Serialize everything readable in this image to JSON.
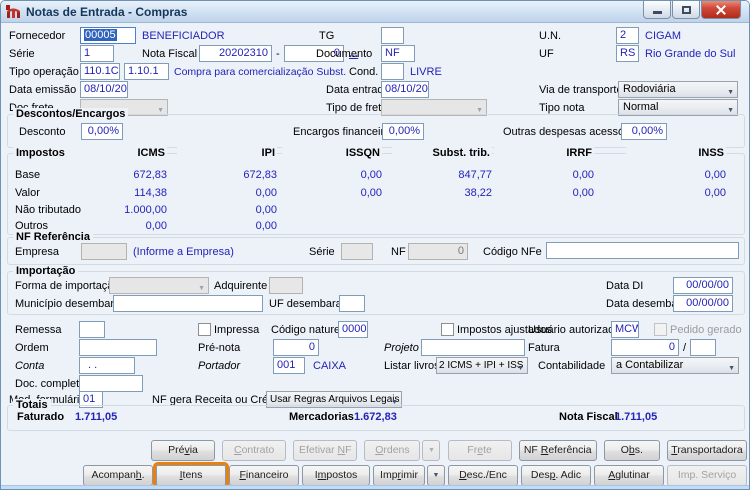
{
  "window": {
    "title": "Notas de Entrada - Compras"
  },
  "icons": {
    "combo_chevron": "▼",
    "dropdown_arrow": "▼"
  },
  "header": {
    "fornecedor_label": "Fornecedor",
    "fornecedor_value": "00005",
    "fornecedor_name": "BENEFICIADOR",
    "tg_label": "TG",
    "tg_value": "",
    "un_label": "U.N.",
    "un_value": "2",
    "un_name": "CIGAM",
    "serie_label": "Série",
    "serie_value": "1",
    "nota_fiscal_label": "Nota Fiscal",
    "nota_fiscal_value": "20202310",
    "nota_fiscal_dash": "-",
    "nota_fiscal_sufixo": "0",
    "nota_fiscal_more": "...",
    "documento_label": "Documento",
    "documento_value": "NF",
    "uf_label": "UF",
    "uf_value": "RS",
    "uf_name": "Rio Grande do Sul",
    "tipo_operacao_label": "Tipo operação",
    "tipo_operacao_value": "110.1C",
    "tipo_operacao_value2": "1.10.1",
    "tipo_operacao_desc": "Compra para comercialização Subst.",
    "cond_pag_label": "Cond. pag.",
    "cond_pag_value": "",
    "cond_pag_desc": "LIVRE",
    "data_emissao_label": "Data emissão",
    "data_emissao_value": "08/10/20",
    "data_entrada_label": "Data entrada",
    "data_entrada_value": "08/10/20",
    "via_transporte_label": "Via de transporte",
    "via_transporte_value": "Rodoviária",
    "doc_frete_label": "Doc frete",
    "doc_frete_value": "",
    "tipo_frete_label": "Tipo de frete",
    "tipo_frete_value": "",
    "tipo_nota_label": "Tipo nota",
    "tipo_nota_value": "Normal"
  },
  "descontos": {
    "title": "Descontos/Encargos",
    "desconto_label": "Desconto",
    "desconto_value": "0,00%",
    "encargos_label": "Encargos financeiros",
    "encargos_value": "0,00%",
    "outras_label": "Outras despesas acessórias",
    "outras_value": "0,00%"
  },
  "impostos": {
    "title": "Impostos",
    "columns": [
      "ICMS",
      "IPI",
      "ISSQN",
      "Subst. trib.",
      "IRRF",
      "INSS"
    ],
    "rows": [
      {
        "label": "Base",
        "values": [
          "672,83",
          "672,83",
          "0,00",
          "847,77",
          "0,00",
          "0,00"
        ]
      },
      {
        "label": "Valor",
        "values": [
          "114,38",
          "0,00",
          "0,00",
          "38,22",
          "0,00",
          "0,00"
        ]
      },
      {
        "label": "Não tributado",
        "values": [
          "1.000,00",
          "0,00",
          "",
          "",
          "",
          ""
        ]
      },
      {
        "label": "Outros",
        "values": [
          "0,00",
          "0,00",
          "",
          "",
          "",
          ""
        ]
      }
    ]
  },
  "nf_referencia": {
    "title": "NF Referência",
    "empresa_label": "Empresa",
    "empresa_value": "",
    "empresa_hint": "(Informe a Empresa)",
    "serie_label": "Série",
    "serie_value": "",
    "nf_label": "NF",
    "nf_value": "0",
    "codigo_nfe_label": "Código NFe",
    "codigo_nfe_value": ""
  },
  "importacao": {
    "title": "Importação",
    "forma_label": "Forma de importação",
    "forma_value": "",
    "adquirente_label": "Adquirente",
    "adquirente_value": "",
    "data_di_label": "Data DI",
    "data_di_value": "00/00/00",
    "municipio_label": "Município desembaraço",
    "municipio_value": "",
    "uf_label": "UF desembaraço",
    "uf_value": "",
    "data_desembaraco_label": "Data desembaraço",
    "data_desembaraco_value": "00/00/00"
  },
  "detalhes": {
    "remessa_label": "Remessa",
    "remessa_value": "",
    "impressa_label": "Impressa",
    "codigo_natureza_label": "Código natureza",
    "codigo_natureza_value": "0000",
    "impostos_ajustados_label": "Impostos ajustados",
    "usuario_label": "Usuário autorizado",
    "usuario_value": "MCW",
    "pedido_gerado_label": "Pedido gerado",
    "ordem_label": "Ordem",
    "ordem_value": "",
    "pre_nota_label": "Pré-nota",
    "pre_nota_value": "0",
    "projeto_label": "Projeto",
    "projeto_value": "",
    "fatura_label": "Fatura",
    "fatura_value": "0",
    "fatura_sep": "/",
    "fatura_value2": "",
    "conta_label": "Conta",
    "conta_value": ". .",
    "portador_label": "Portador",
    "portador_value": "001",
    "portador_name": "CAIXA",
    "listar_livros_label": "Listar livros",
    "listar_livros_value": "2 ICMS + IPI + ISS",
    "contabilidade_label": "Contabilidade",
    "contabilidade_value": "a Contabilizar",
    "doc_completo_label": "Doc. completo",
    "doc_completo_value": "",
    "mod_formulario_label": "Mod. formulário",
    "mod_formulario_value": "01",
    "nf_gera_label": "NF gera Receita ou Crédito",
    "nf_gera_value": "Usar Regras Arquivos Legais"
  },
  "totais": {
    "title": "Totais",
    "faturado_label": "Faturado",
    "faturado_value": "1.711,05",
    "mercadorias_label": "Mercadorias",
    "mercadorias_value": "1.672,83",
    "nota_fiscal_label": "Nota Fiscal",
    "nota_fiscal_value": "1.711,05"
  },
  "buttons": {
    "row1": [
      {
        "pre": "Pré",
        "u": "v",
        "post": "ia"
      },
      {
        "pre": "",
        "u": "C",
        "post": "ontrato"
      },
      {
        "pre": "Efetivar ",
        "u": "N",
        "post": "F"
      },
      {
        "pre": "",
        "u": "O",
        "post": "rdens"
      },
      {
        "pre": "Fr",
        "u": "e",
        "post": "te"
      },
      {
        "pre": "NF ",
        "u": "R",
        "post": "eferência"
      },
      {
        "pre": "O",
        "u": "b",
        "post": "s."
      },
      {
        "pre": "",
        "u": "T",
        "post": "ransportadora"
      }
    ],
    "row2": [
      {
        "pre": "Acompan",
        "u": "h",
        "post": "."
      },
      {
        "pre": "",
        "u": "I",
        "post": "tens"
      },
      {
        "pre": "",
        "u": "F",
        "post": "inanceiro"
      },
      {
        "pre": "I",
        "u": "m",
        "post": "postos"
      },
      {
        "pre": "Imp",
        "u": "r",
        "post": "imir"
      },
      {
        "pre": "",
        "u": "D",
        "post": "esc./Enc"
      },
      {
        "pre": "Des",
        "u": "p",
        "post": ". Adic"
      },
      {
        "pre": "",
        "u": "A",
        "post": "glutinar"
      },
      {
        "pre": "Imp. Serviço",
        "u": "",
        "post": ""
      }
    ]
  },
  "colors": {
    "highlight_orange": "#E8820C",
    "value_navy": "#2323B8",
    "selection_blue": "#2F63BE"
  }
}
